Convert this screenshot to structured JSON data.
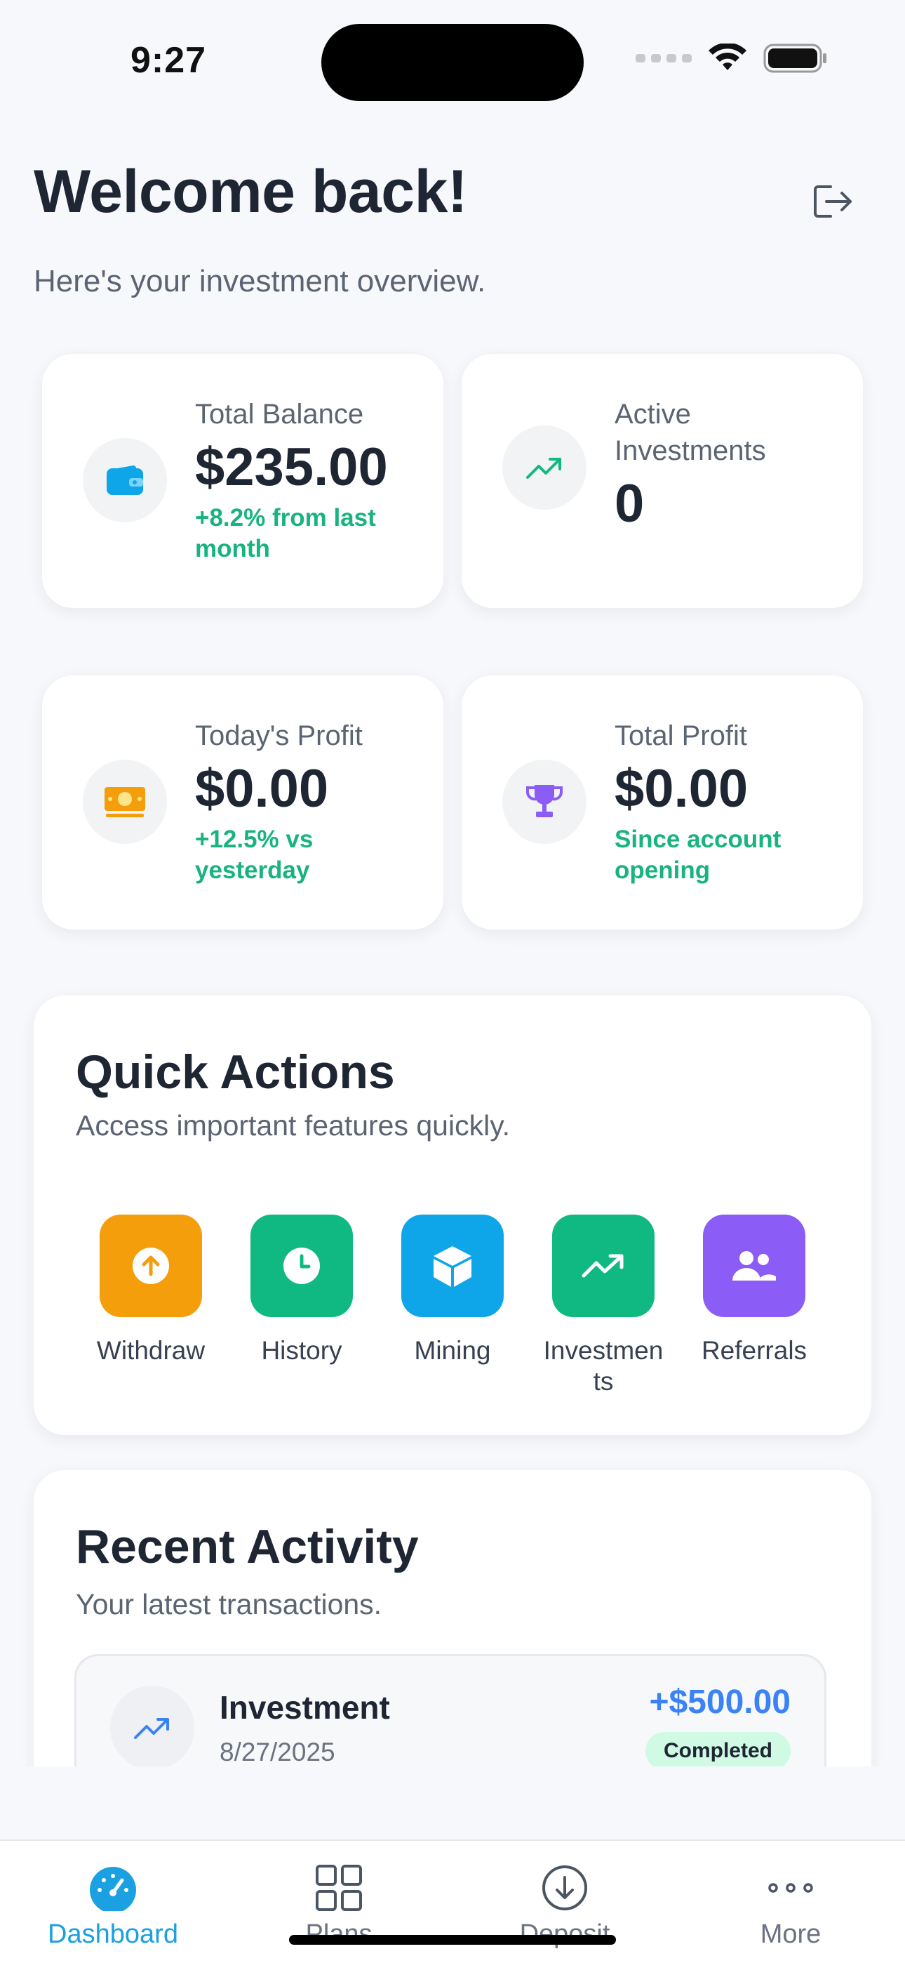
{
  "status_bar": {
    "time": "9:27"
  },
  "header": {
    "title": "Welcome back!",
    "subtitle": "Here's your investment overview.",
    "logout_icon": "logout-icon"
  },
  "stats": [
    {
      "label": "Total Balance",
      "value": "$235.00",
      "note": "+8.2% from last month",
      "icon": "wallet-icon",
      "icon_color": "#0ea5e9"
    },
    {
      "label": "Active Investments",
      "value": "0",
      "note": "",
      "icon": "trend-up-icon",
      "icon_color": "#10b981"
    },
    {
      "label": "Today's Profit",
      "value": "$0.00",
      "note": "+12.5% vs yesterday",
      "icon": "money-icon",
      "icon_color": "#f59e0b"
    },
    {
      "label": "Total Profit",
      "value": "$0.00",
      "note": "Since account opening",
      "icon": "trophy-icon",
      "icon_color": "#8b5cf6"
    }
  ],
  "quick_actions": {
    "title": "Quick Actions",
    "subtitle": "Access important features quickly.",
    "items": [
      {
        "label": "Withdraw",
        "icon": "arrow-up-circle-icon",
        "color": "#f59e0b"
      },
      {
        "label": "History",
        "icon": "clock-icon",
        "color": "#10b981"
      },
      {
        "label": "Mining",
        "icon": "cube-icon",
        "color": "#0ea5e9"
      },
      {
        "label": "Investmen ts",
        "icon": "trend-up-icon",
        "color": "#10b981"
      },
      {
        "label": "Referrals",
        "icon": "users-icon",
        "color": "#8b5cf6"
      }
    ]
  },
  "recent_activity": {
    "title": "Recent Activity",
    "subtitle": "Your latest transactions.",
    "items": [
      {
        "title": "Investment",
        "date": "8/27/2025",
        "amount": "+$500.00",
        "status": "Completed",
        "icon": "trend-up-icon"
      }
    ]
  },
  "tab_bar": {
    "tabs": [
      {
        "label": "Dashboard",
        "icon": "speedometer-icon",
        "active": true
      },
      {
        "label": "Plans",
        "icon": "grid-icon",
        "active": false
      },
      {
        "label": "Deposit",
        "icon": "download-circle-icon",
        "active": false
      },
      {
        "label": "More",
        "icon": "more-dots-icon",
        "active": false
      }
    ]
  },
  "colors": {
    "accent": "#1ba0e2",
    "positive": "#19b37f",
    "amount": "#3b82f6"
  }
}
